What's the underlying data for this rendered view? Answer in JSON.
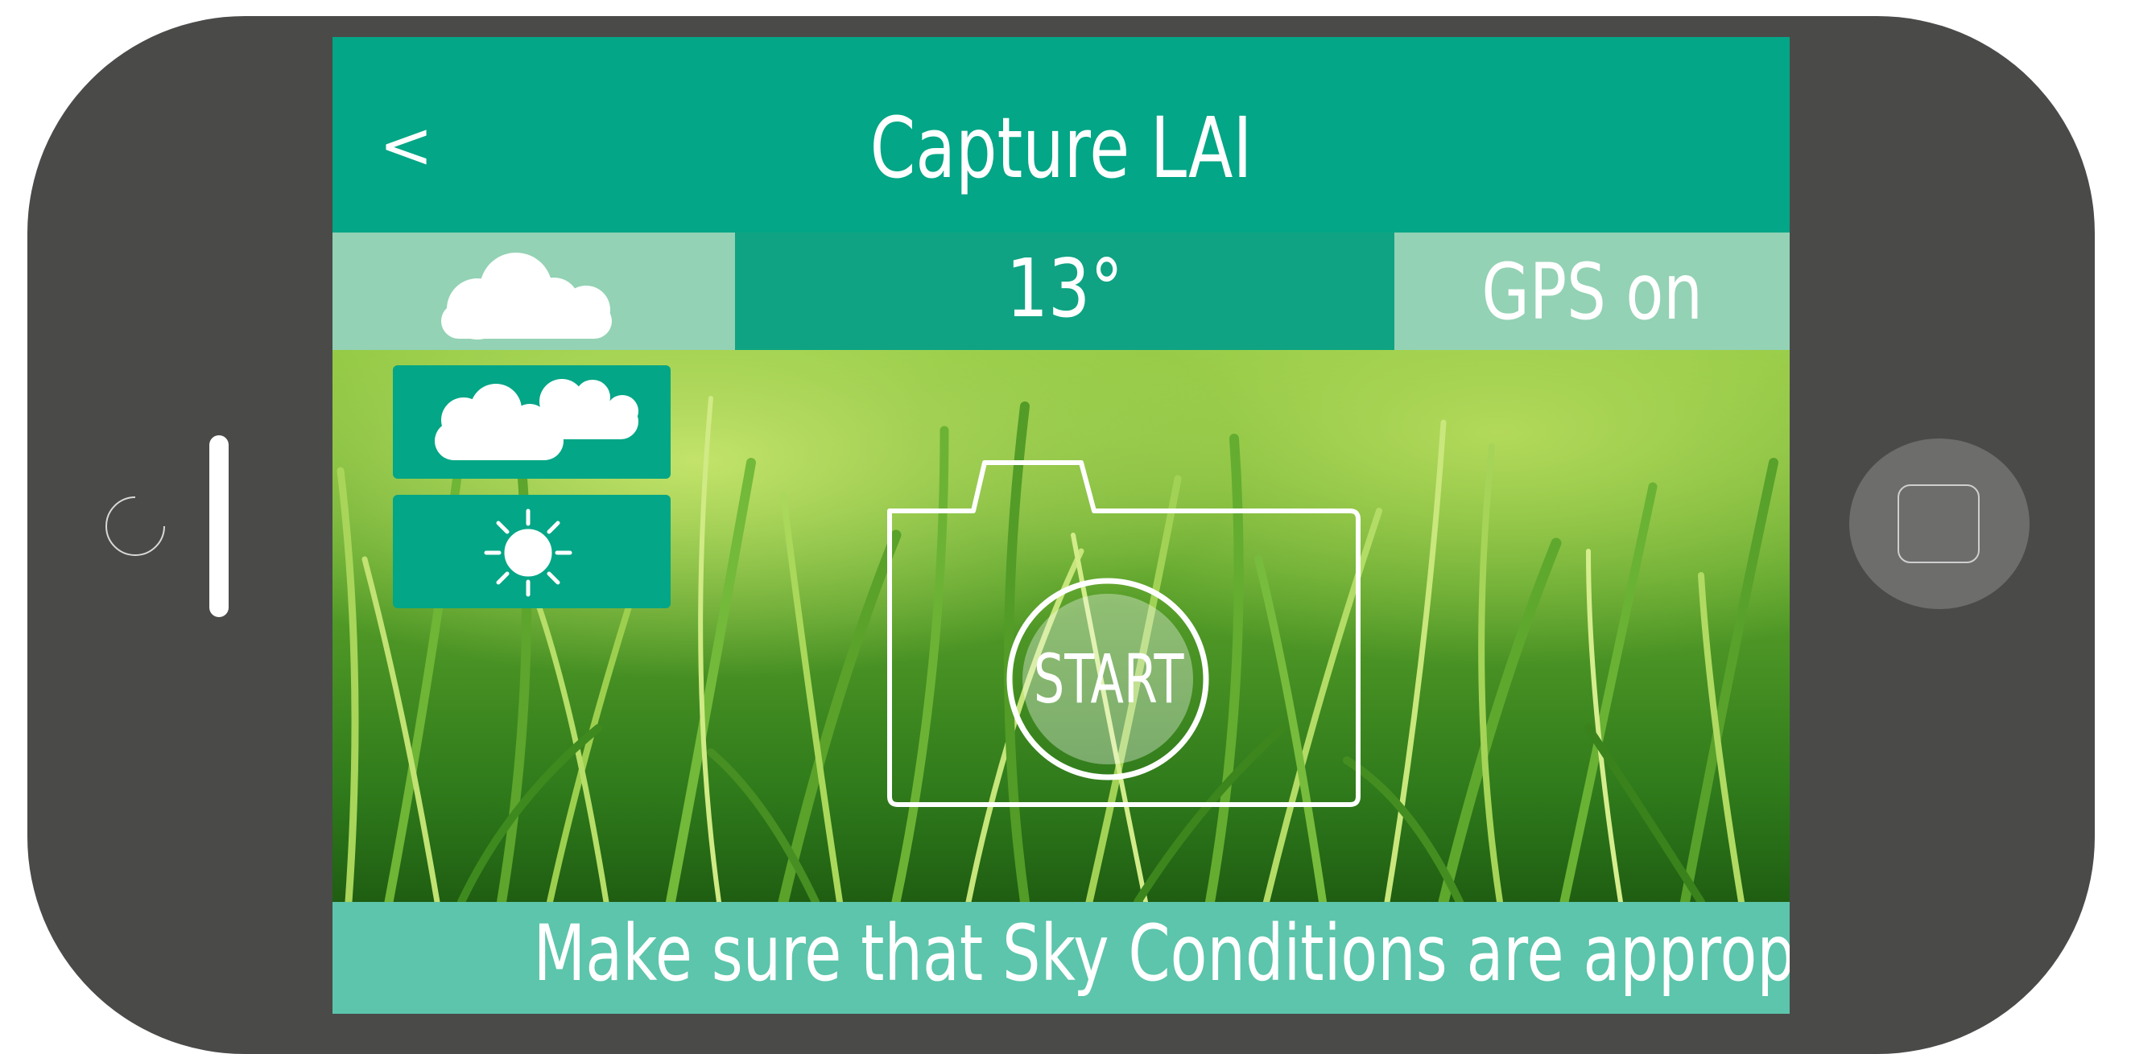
{
  "app": {
    "title": "Capture LAI",
    "back_label": "<"
  },
  "status_bar": {
    "weather_icon": "cloud-icon",
    "temperature": "13°",
    "gps_label": "GPS on"
  },
  "sky_conditions": {
    "options": [
      {
        "icon": "clouds-icon",
        "label": "Cloudy"
      },
      {
        "icon": "sun-icon",
        "label": "Sunny"
      }
    ]
  },
  "capture": {
    "start_label": "START",
    "camera_icon": "camera-icon"
  },
  "footer": {
    "message": "Make sure that Sky Conditions are appropriate!"
  },
  "colors": {
    "primary": "#03a686",
    "light": "#93d2b4",
    "footer": "#5cc5ab",
    "device": "#4a4a49"
  }
}
